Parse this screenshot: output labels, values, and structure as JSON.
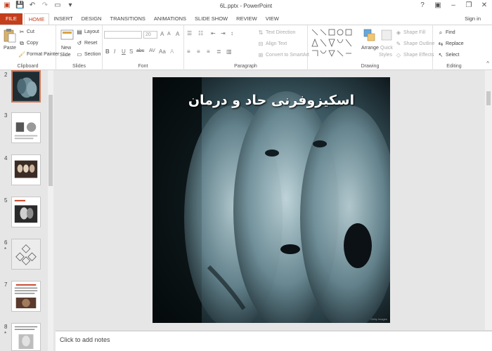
{
  "window": {
    "title": "6L.pptx - PowerPoint",
    "signin": "Sign in"
  },
  "tabs": [
    "FILE",
    "HOME",
    "INSERT",
    "DESIGN",
    "TRANSITIONS",
    "ANIMATIONS",
    "SLIDE SHOW",
    "REVIEW",
    "VIEW"
  ],
  "active_tab": "HOME",
  "ribbon": {
    "clipboard": {
      "label": "Clipboard",
      "paste": "Paste",
      "cut": "Cut",
      "copy": "Copy",
      "format_painter": "Format Painter"
    },
    "slides": {
      "label": "Slides",
      "new_slide_1": "New",
      "new_slide_2": "Slide",
      "layout": "Layout",
      "reset": "Reset",
      "section": "Section"
    },
    "font": {
      "label": "Font",
      "size": "20",
      "bold": "B",
      "italic": "I",
      "underline": "U",
      "shadow": "S",
      "strike": "abc",
      "spacing": "AV",
      "case": "Aa",
      "grow": "A",
      "shrink": "A",
      "clear": "A"
    },
    "paragraph": {
      "label": "Paragraph",
      "text_direction": "Text Direction",
      "align_text": "Align Text",
      "smartart": "Convert to SmartArt"
    },
    "drawing": {
      "label": "Drawing",
      "arrange": "Arrange",
      "quick_styles_1": "Quick",
      "quick_styles_2": "Styles",
      "shape_fill": "Shape Fill",
      "shape_outline": "Shape Outline",
      "shape_effects": "Shape Effects"
    },
    "editing": {
      "label": "Editing",
      "find": "Find",
      "replace": "Replace",
      "select": "Select"
    }
  },
  "slides_panel": {
    "items": [
      {
        "num": "2",
        "star": ""
      },
      {
        "num": "3",
        "star": ""
      },
      {
        "num": "4",
        "star": ""
      },
      {
        "num": "5",
        "star": ""
      },
      {
        "num": "6",
        "star": "*"
      },
      {
        "num": "7",
        "star": ""
      },
      {
        "num": "8",
        "star": "*"
      }
    ]
  },
  "slide": {
    "title": "اسکیزوفرنی حاد و درمان",
    "credit": "Getty Images"
  },
  "notes": {
    "placeholder": "Click to add notes"
  },
  "colors": {
    "accent": "#c43e1c",
    "selected_thumb": "#d27656"
  }
}
